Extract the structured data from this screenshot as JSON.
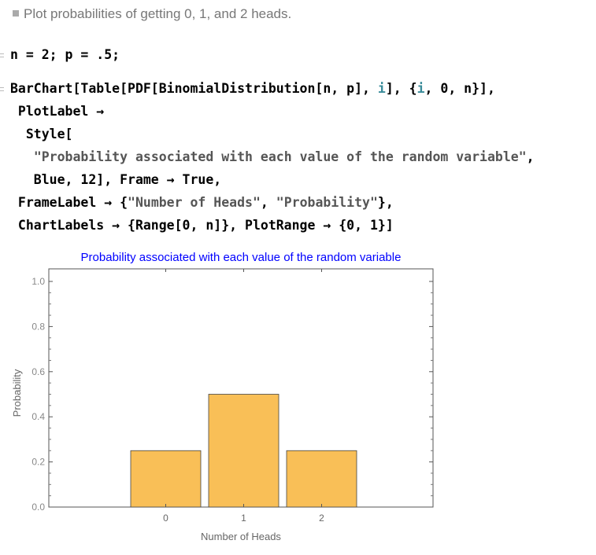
{
  "text_cell": "Plot probabilities of  getting 0, 1, and 2 heads.",
  "input1": "n = 2; p = .5;",
  "input2": {
    "l1a": "BarChart[Table[PDF[BinomialDistribution[n, p], ",
    "l1i": "i",
    "l1b": "], {",
    "l1i2": "i",
    "l1c": ", 0, n}],",
    "l2": " PlotLabel →",
    "l3": "  Style[",
    "l4": "\"Probability associated with each value of the random variable\"",
    "l4b": ",",
    "l5": "   Blue, 12], Frame → True,",
    "l6a": " FrameLabel → {",
    "l6s1": "\"Number of Heads\"",
    "l6m": ", ",
    "l6s2": "\"Probability\"",
    "l6b": "},",
    "l7": " ChartLabels → {Range[0, n]}, PlotRange → {0, 1}]"
  },
  "chart_data": {
    "type": "bar",
    "title": "Probability associated with each value of the random variable",
    "title_color": "#0000ff",
    "xlabel": "Number of Heads",
    "ylabel": "Probability",
    "categories": [
      "0",
      "1",
      "2"
    ],
    "values": [
      0.25,
      0.5,
      0.25
    ],
    "ylim": [
      0,
      1
    ],
    "yticks": [
      "0.0",
      "0.2",
      "0.4",
      "0.6",
      "0.8",
      "1.0"
    ],
    "bar_color": "#f9bf57",
    "grid": false
  }
}
